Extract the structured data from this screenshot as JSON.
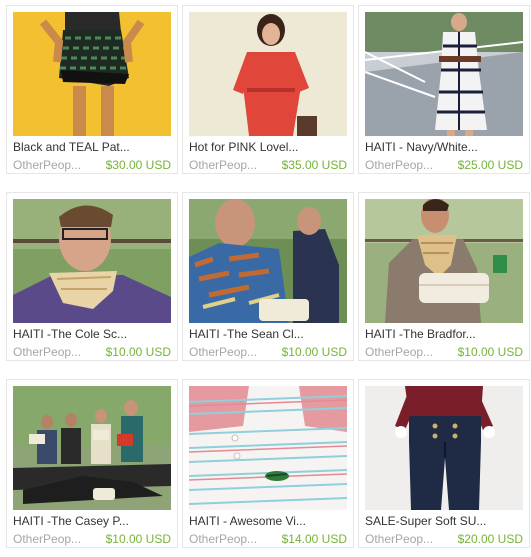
{
  "currency": "USD",
  "items": [
    {
      "title": "Black and TEAL Pat...",
      "shop": "OtherPeop...",
      "price": "$30.00 USD",
      "image": "black-teal-skirt-photo"
    },
    {
      "title": "Hot for PINK Lovel...",
      "shop": "OtherPeop...",
      "price": "$35.00 USD",
      "image": "pink-dress-photo"
    },
    {
      "title": "HAITI - Navy/White...",
      "shop": "OtherPeop...",
      "price": "$25.00 USD",
      "image": "navy-white-dress-photo"
    },
    {
      "title": "HAITI -The Cole Sc...",
      "shop": "OtherPeop...",
      "price": "$10.00 USD",
      "image": "cole-scarf-photo"
    },
    {
      "title": "HAITI -The Sean Cl...",
      "shop": "OtherPeop...",
      "price": "$10.00 USD",
      "image": "sean-clutch-photo"
    },
    {
      "title": "HAITI -The Bradfor...",
      "shop": "OtherPeop...",
      "price": "$10.00 USD",
      "image": "bradford-clutch-photo"
    },
    {
      "title": "HAITI -The Casey P...",
      "shop": "OtherPeop...",
      "price": "$10.00 USD",
      "image": "casey-group-photo"
    },
    {
      "title": "HAITI - Awesome Vi...",
      "shop": "OtherPeop...",
      "price": "$14.00 USD",
      "image": "striped-polo-photo"
    },
    {
      "title": "SALE-Super Soft SU...",
      "shop": "OtherPeop...",
      "price": "$20.00 USD",
      "image": "high-waist-jeans-photo"
    }
  ]
}
